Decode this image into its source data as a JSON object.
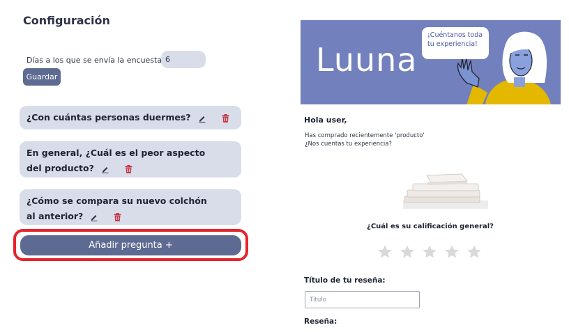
{
  "config": {
    "title": "Configuración",
    "days_label": "Días a los que se envía la encuesta:",
    "days_value": "6",
    "save_label": "Guardar",
    "questions": [
      {
        "text": "¿Con cuántas personas duermes?"
      },
      {
        "text": "En general, ¿Cuál es el peor aspecto del producto?"
      },
      {
        "text": "¿Cómo se compara su nuevo colchón al anterior?"
      }
    ],
    "add_label": "Añadir pregunta +",
    "icons": {
      "edit": "edit-pencil-icon",
      "delete": "trash-icon"
    }
  },
  "preview": {
    "brand": "Luuna",
    "bubble_line1": "¡Cuéntanos toda",
    "bubble_line2": "tu experiencia!",
    "greeting": "Hola user,",
    "message_line1": "Has comprado recientemente 'producto'",
    "message_line2": "¿Nos cuentas tu experiencia?",
    "rating_question": "¿Cuál es su calificación general?",
    "star_count": 5,
    "review_title_label": "Título de tu reseña:",
    "review_title_placeholder": "Título",
    "review_label": "Reseña:"
  },
  "colors": {
    "accent": "#5d6a92",
    "card_bg": "#d8dde9",
    "banner_bg": "#7280bd",
    "highlight": "#e5242c",
    "trash": "#c0394b",
    "star": "#d9d9d9"
  }
}
